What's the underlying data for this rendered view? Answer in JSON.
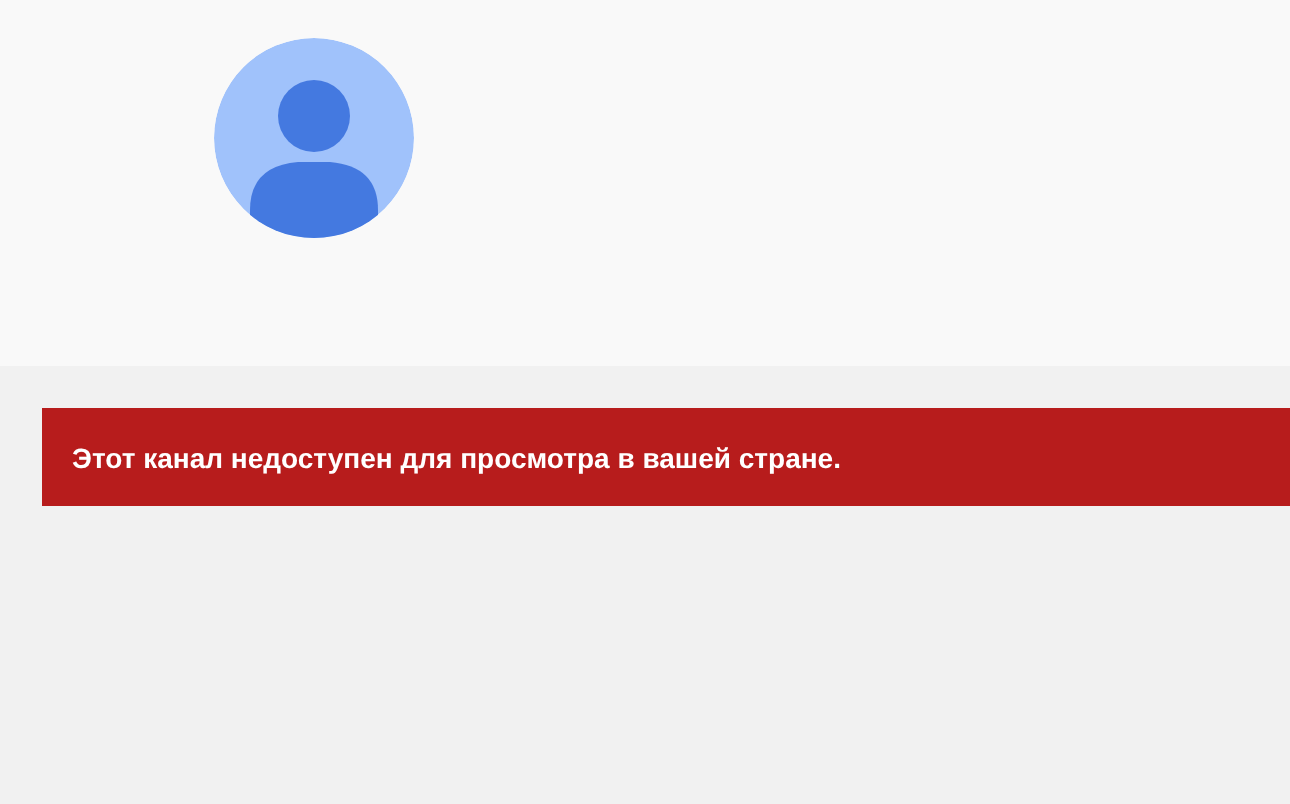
{
  "notice": {
    "message": "Этот канал недоступен для просмотра в вашей стране."
  }
}
